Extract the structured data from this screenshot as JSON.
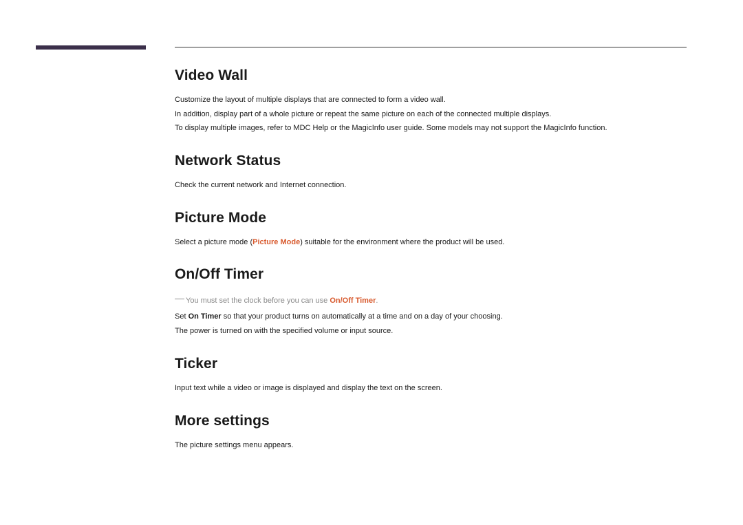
{
  "sections": {
    "video_wall": {
      "heading": "Video Wall",
      "line1": "Customize the layout of multiple displays that are connected to form a video wall.",
      "line2": "In addition, display part of a whole picture or repeat the same picture on each of the connected multiple displays.",
      "line3": "To display multiple images, refer to MDC Help or the MagicInfo user guide. Some models may not support the MagicInfo function."
    },
    "network_status": {
      "heading": "Network Status",
      "line1": "Check the current network and Internet connection."
    },
    "picture_mode": {
      "heading": "Picture Mode",
      "prefix": "Select a picture mode (",
      "highlight": "Picture Mode",
      "suffix": ") suitable for the environment where the product will be used."
    },
    "on_off_timer": {
      "heading": "On/Off Timer",
      "note_dash": "―",
      "note_prefix": "You must set the clock before you can use ",
      "note_highlight": "On/Off Timer",
      "note_suffix": ".",
      "line1_prefix": "Set ",
      "line1_bold": "On Timer",
      "line1_suffix": " so that your product turns on automatically at a time and on a day of your choosing.",
      "line2": "The power is turned on with the specified volume or input source."
    },
    "ticker": {
      "heading": "Ticker",
      "line1": "Input text while a video or image is displayed and display the text on the screen."
    },
    "more_settings": {
      "heading": "More settings",
      "line1": "The picture settings menu appears."
    }
  }
}
